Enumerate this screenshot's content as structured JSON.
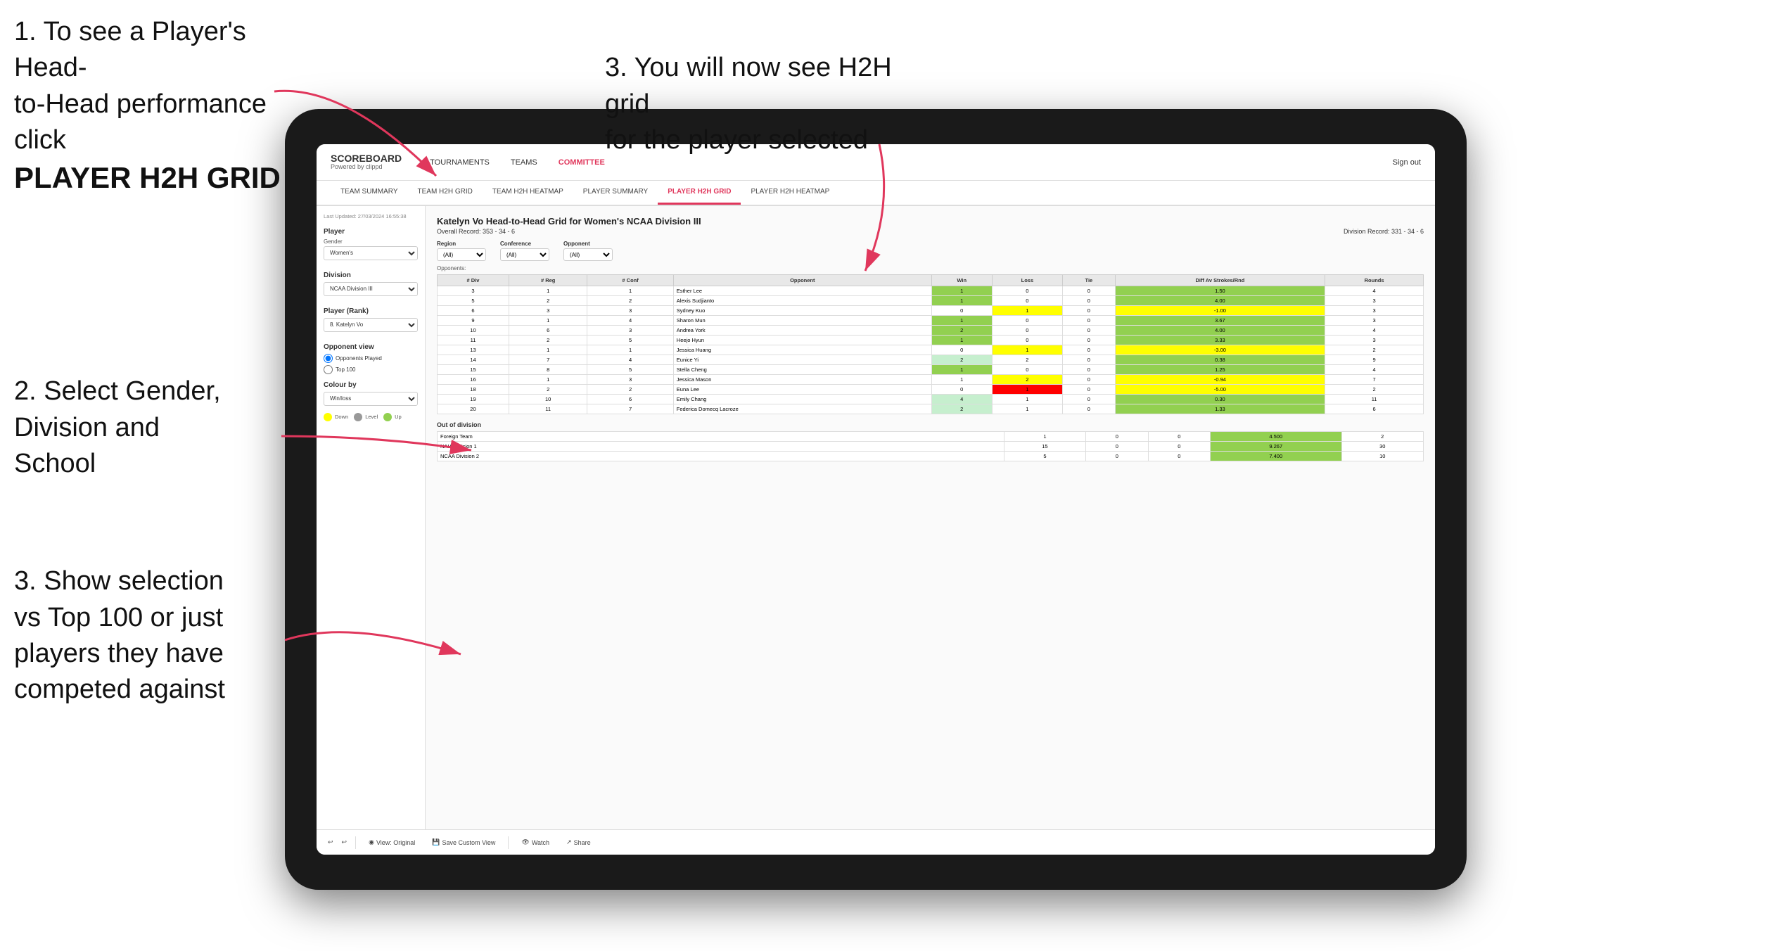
{
  "instructions": {
    "top_left_line1": "1. To see a Player's Head-",
    "top_left_line2": "to-Head performance click",
    "top_left_bold": "PLAYER H2H GRID",
    "top_right": "3. You will now see H2H grid\nfor the player selected",
    "mid_left_title": "2. Select Gender,\nDivision and\nSchool",
    "bottom_left_title": "3. Show selection\nvs Top 100 or just\nplayers they have\ncompeted against"
  },
  "nav": {
    "logo": "SCOREBOARD",
    "logo_sub": "Powered by clippd",
    "links": [
      "TOURNAMENTS",
      "TEAMS",
      "COMMITTEE"
    ],
    "active_link": "COMMITTEE",
    "sign_out": "Sign out"
  },
  "sub_nav": {
    "links": [
      "TEAM SUMMARY",
      "TEAM H2H GRID",
      "TEAM H2H HEATMAP",
      "PLAYER SUMMARY",
      "PLAYER H2H GRID",
      "PLAYER H2H HEATMAP"
    ],
    "active": "PLAYER H2H GRID"
  },
  "sidebar": {
    "last_updated": "Last Updated: 27/03/2024\n16:55:38",
    "player_section": "Player",
    "gender_label": "Gender",
    "gender_value": "Women's",
    "division_label": "Division",
    "division_value": "NCAA Division III",
    "player_rank_label": "Player (Rank)",
    "player_rank_value": "8. Katelyn Vo",
    "opponent_view_label": "Opponent view",
    "radio_opponents": "Opponents Played",
    "radio_top100": "Top 100",
    "colour_label": "Colour by",
    "colour_value": "Win/loss",
    "legend": {
      "down_label": "Down",
      "level_label": "Level",
      "up_label": "Up"
    }
  },
  "main": {
    "title": "Katelyn Vo Head-to-Head Grid for Women's NCAA Division III",
    "overall_record": "Overall Record: 353 - 34 - 6",
    "division_record": "Division Record: 331 - 34 - 6",
    "filters": {
      "region_label": "Region",
      "conference_label": "Conference",
      "opponent_label": "Opponent",
      "opponents_label": "Opponents:",
      "region_value": "(All)",
      "conference_value": "(All)",
      "opponent_value": "(All)"
    },
    "table_headers": [
      "# Div",
      "# Reg",
      "# Conf",
      "Opponent",
      "Win",
      "Loss",
      "Tie",
      "Diff Av Strokes/Rnd",
      "Rounds"
    ],
    "rows": [
      {
        "div": "3",
        "reg": "1",
        "conf": "1",
        "opponent": "Esther Lee",
        "win": "1",
        "loss": "0",
        "tie": "0",
        "diff": "1.50",
        "rounds": "4",
        "win_color": "green"
      },
      {
        "div": "5",
        "reg": "2",
        "conf": "2",
        "opponent": "Alexis Sudjianto",
        "win": "1",
        "loss": "0",
        "tie": "0",
        "diff": "4.00",
        "rounds": "3",
        "win_color": "green"
      },
      {
        "div": "6",
        "reg": "3",
        "conf": "3",
        "opponent": "Sydney Kuo",
        "win": "0",
        "loss": "1",
        "tie": "0",
        "diff": "-1.00",
        "rounds": "3",
        "loss_color": "yellow"
      },
      {
        "div": "9",
        "reg": "1",
        "conf": "4",
        "opponent": "Sharon Mun",
        "win": "1",
        "loss": "0",
        "tie": "0",
        "diff": "3.67",
        "rounds": "3",
        "win_color": "green"
      },
      {
        "div": "10",
        "reg": "6",
        "conf": "3",
        "opponent": "Andrea York",
        "win": "2",
        "loss": "0",
        "tie": "0",
        "diff": "4.00",
        "rounds": "4",
        "win_color": "green"
      },
      {
        "div": "11",
        "reg": "2",
        "conf": "5",
        "opponent": "Heejo Hyun",
        "win": "1",
        "loss": "0",
        "tie": "0",
        "diff": "3.33",
        "rounds": "3",
        "win_color": "green"
      },
      {
        "div": "13",
        "reg": "1",
        "conf": "1",
        "opponent": "Jessica Huang",
        "win": "0",
        "loss": "1",
        "tie": "0",
        "diff": "-3.00",
        "rounds": "2",
        "loss_color": "yellow"
      },
      {
        "div": "14",
        "reg": "7",
        "conf": "4",
        "opponent": "Eunice Yi",
        "win": "2",
        "loss": "2",
        "tie": "0",
        "diff": "0.38",
        "rounds": "9",
        "win_color": "light-green"
      },
      {
        "div": "15",
        "reg": "8",
        "conf": "5",
        "opponent": "Stella Cheng",
        "win": "1",
        "loss": "0",
        "tie": "0",
        "diff": "1.25",
        "rounds": "4",
        "win_color": "green"
      },
      {
        "div": "16",
        "reg": "1",
        "conf": "3",
        "opponent": "Jessica Mason",
        "win": "1",
        "loss": "2",
        "tie": "0",
        "diff": "-0.94",
        "rounds": "7",
        "loss_color": "yellow"
      },
      {
        "div": "18",
        "reg": "2",
        "conf": "2",
        "opponent": "Euna Lee",
        "win": "0",
        "loss": "1",
        "tie": "0",
        "diff": "-5.00",
        "rounds": "2",
        "loss_color": "red"
      },
      {
        "div": "19",
        "reg": "10",
        "conf": "6",
        "opponent": "Emily Chang",
        "win": "4",
        "loss": "1",
        "tie": "0",
        "diff": "0.30",
        "rounds": "11",
        "win_color": "light-green"
      },
      {
        "div": "20",
        "reg": "11",
        "conf": "7",
        "opponent": "Federica Domecq Lacroze",
        "win": "2",
        "loss": "1",
        "tie": "0",
        "diff": "1.33",
        "rounds": "6",
        "win_color": "light-green"
      }
    ],
    "out_of_division_title": "Out of division",
    "out_of_division_rows": [
      {
        "name": "Foreign Team",
        "win": "1",
        "loss": "0",
        "tie": "0",
        "diff": "4.500",
        "rounds": "2"
      },
      {
        "name": "NAIA Division 1",
        "win": "15",
        "loss": "0",
        "tie": "0",
        "diff": "9.267",
        "rounds": "30"
      },
      {
        "name": "NCAA Division 2",
        "win": "5",
        "loss": "0",
        "tie": "0",
        "diff": "7.400",
        "rounds": "10"
      }
    ]
  },
  "toolbar": {
    "view_original": "View: Original",
    "save_custom": "Save Custom View",
    "watch": "Watch",
    "share": "Share"
  }
}
